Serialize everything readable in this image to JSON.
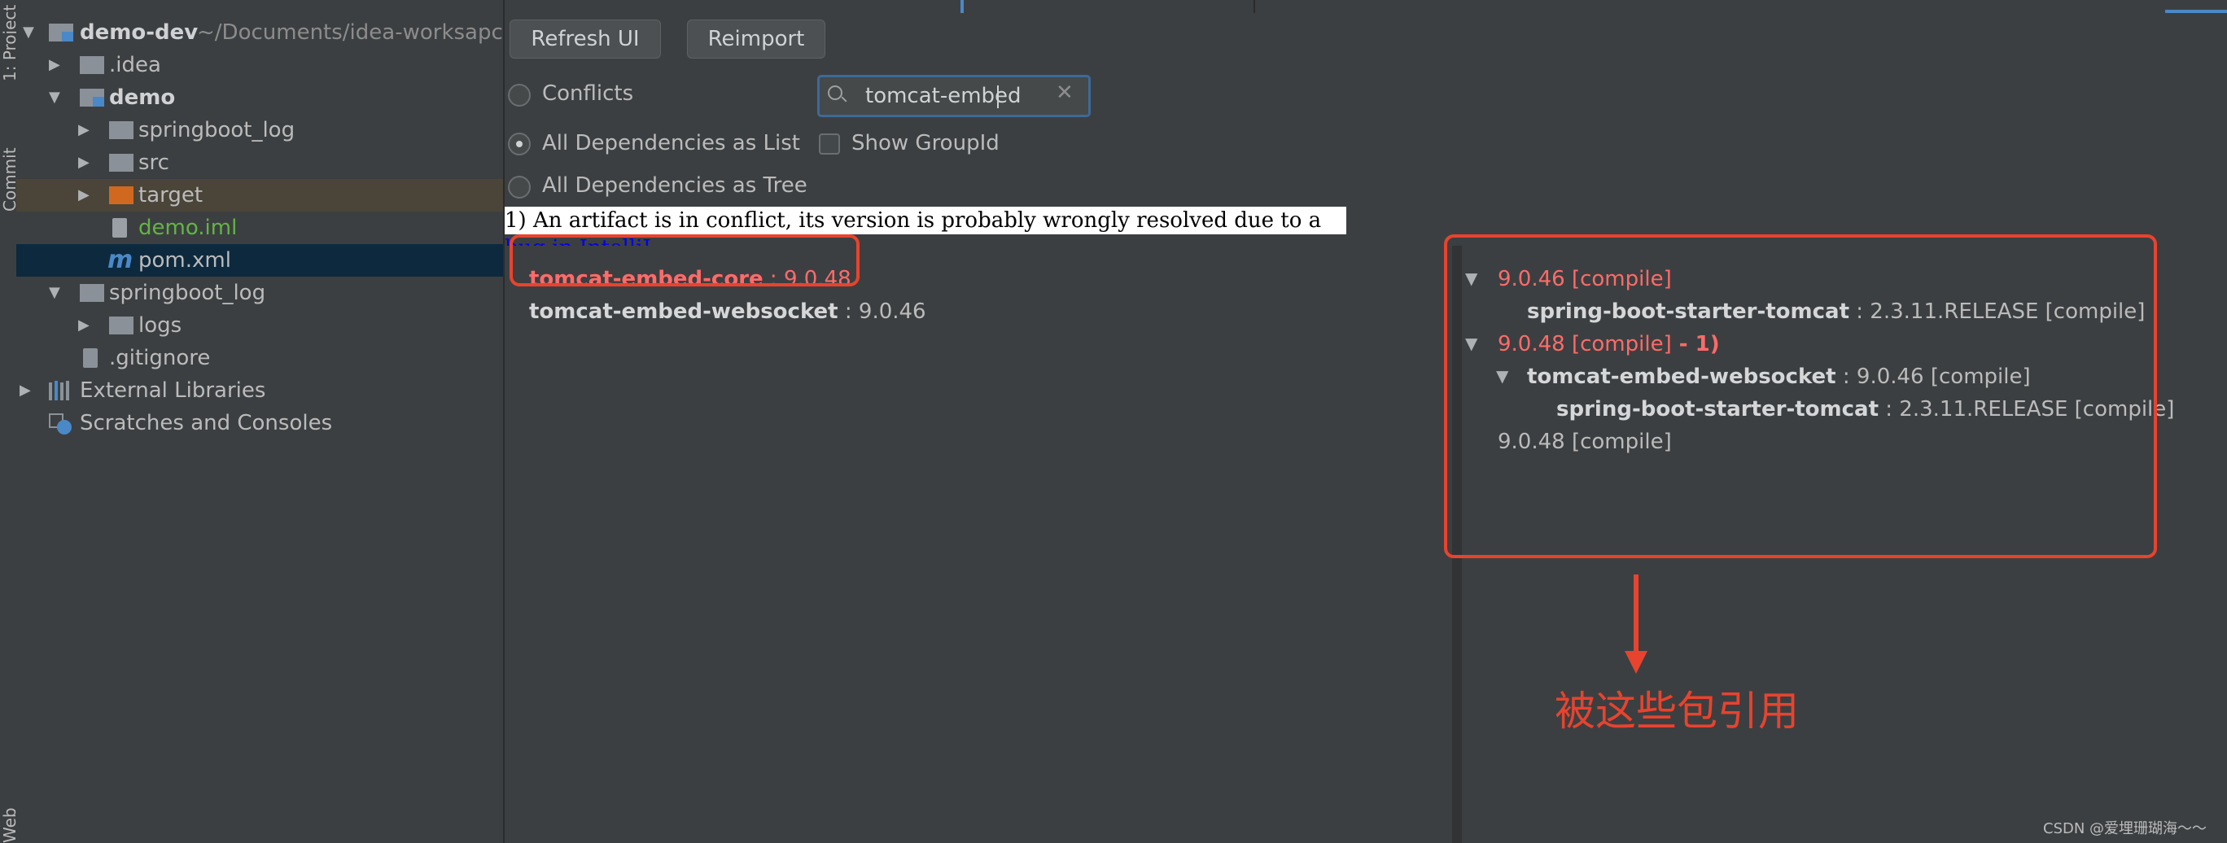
{
  "sidebar": {
    "tabs": [
      "1: Project",
      "Commit",
      "Web"
    ],
    "tree": [
      {
        "name": "demo-dev",
        "path": "~/Documents/idea-worksapce"
      },
      {
        "name": ".idea"
      },
      {
        "name": "demo"
      },
      {
        "name": "springboot_log"
      },
      {
        "name": "src"
      },
      {
        "name": "target"
      },
      {
        "name": "demo.iml"
      },
      {
        "name": "pom.xml"
      },
      {
        "name": "springboot_log"
      },
      {
        "name": "logs"
      },
      {
        "name": ".gitignore"
      },
      {
        "name": "External Libraries"
      },
      {
        "name": "Scratches and Consoles"
      }
    ]
  },
  "toolbar": {
    "refresh_label": "Refresh UI",
    "reimport_label": "Reimport"
  },
  "options": {
    "conflicts": "Conflicts",
    "as_list": "All Dependencies as List",
    "as_tree": "All Dependencies as Tree",
    "show_groupid": "Show GroupId",
    "selected": "as_list"
  },
  "search": {
    "value": "tomcat-embed"
  },
  "note": {
    "text": "1) An artifact is in conflict, its version is probably wrongly resolved due to a ",
    "link": "bug in IntelliJ",
    "end": "."
  },
  "left_list": [
    {
      "name": "tomcat-embed-core",
      "version": " : 9.0.48",
      "conflict": true
    },
    {
      "name": "tomcat-embed-websocket",
      "version": " : 9.0.46",
      "conflict": false
    }
  ],
  "right_tree": [
    {
      "text": "9.0.46 [compile]"
    },
    {
      "name": "spring-boot-starter-tomcat",
      "text": " : 2.3.11.RELEASE [compile]"
    },
    {
      "text": "9.0.48 [compile]",
      "suffix": " - 1)"
    },
    {
      "name": "tomcat-embed-websocket",
      "text": " : 9.0.46 [compile]"
    },
    {
      "name": "spring-boot-starter-tomcat",
      "text": " : 2.3.11.RELEASE [compile]"
    },
    {
      "text": "9.0.48 [compile]"
    }
  ],
  "annotation": {
    "text": "被这些包引用"
  },
  "watermark": {
    "text": "CSDN @爱埋珊瑚海～～"
  },
  "colors": {
    "accent": "#e8432e",
    "conflict": "#ff6b68",
    "folder": "#8a9199",
    "source_folder": "#6b90c0",
    "excluded_folder": "#d0691f"
  }
}
